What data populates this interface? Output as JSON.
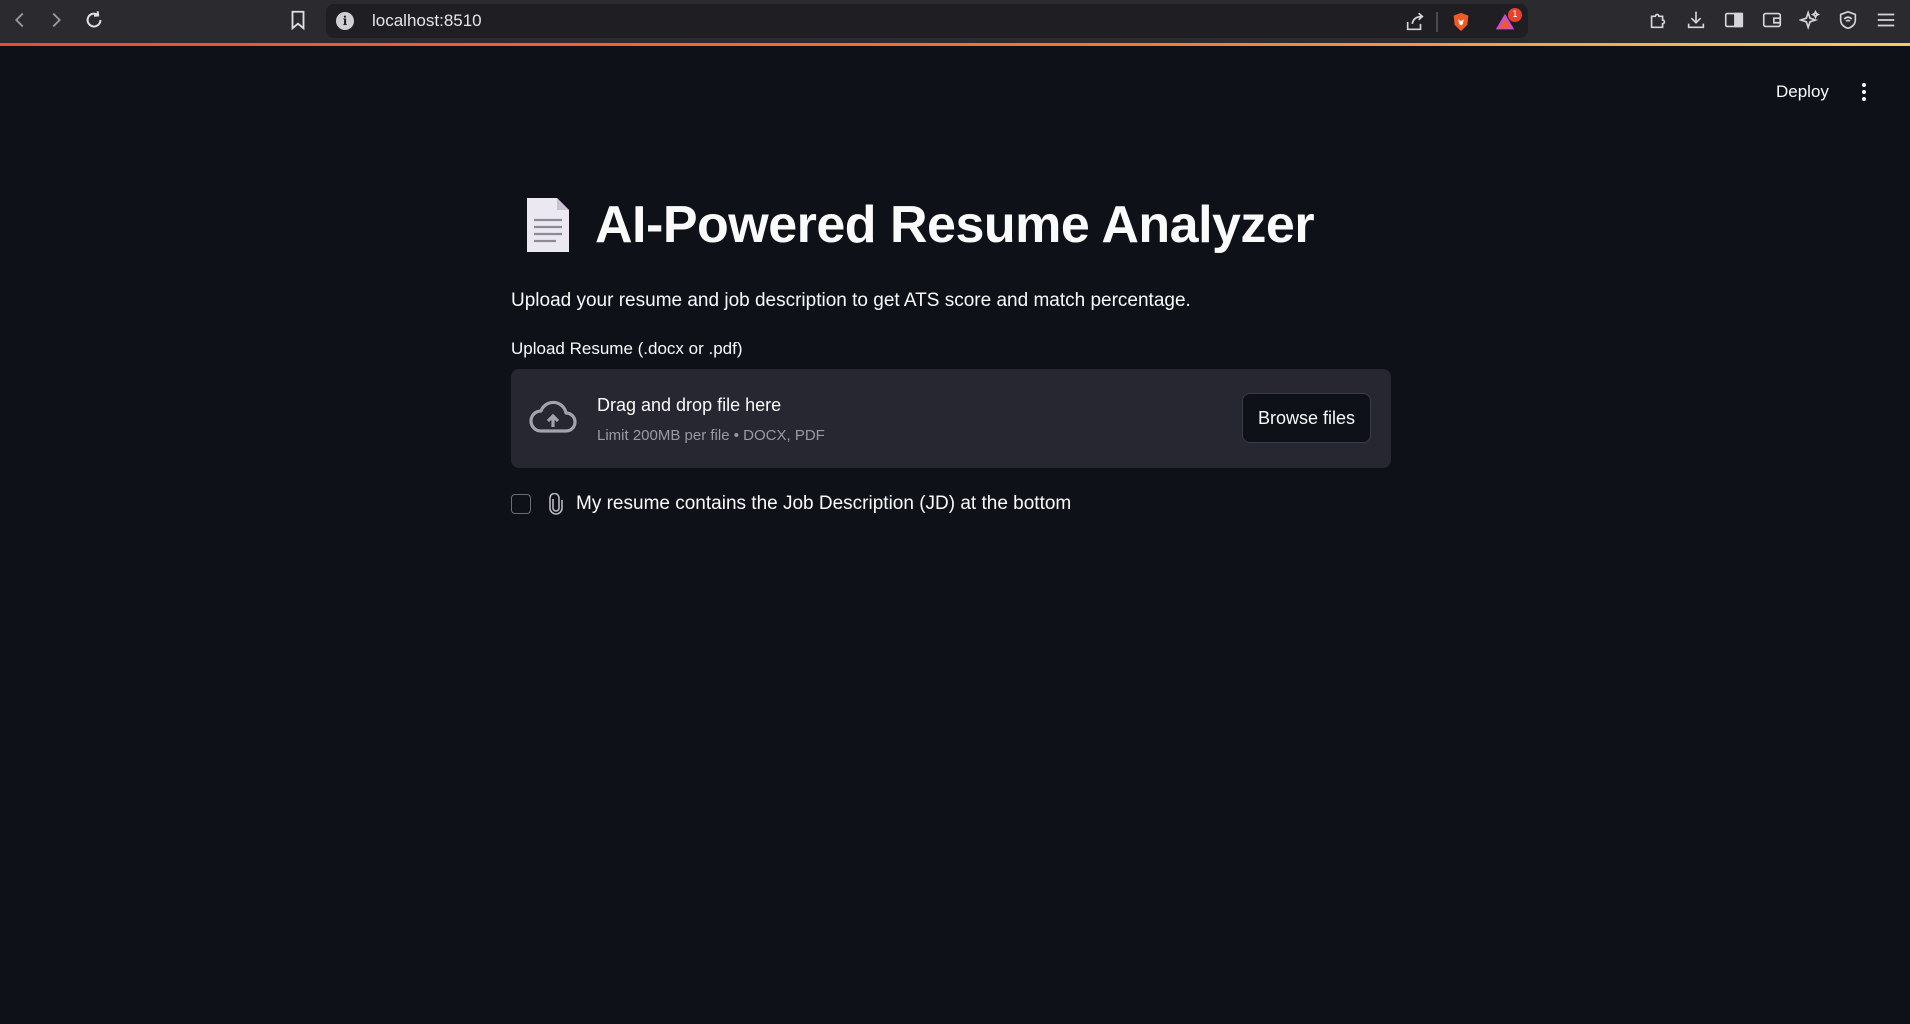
{
  "browser": {
    "url": "localhost:8510",
    "notification_count": "1"
  },
  "header": {
    "deploy_label": "Deploy"
  },
  "main": {
    "title": "AI-Powered Resume Analyzer",
    "subtitle": "Upload your resume and job description to get ATS score and match percentage.",
    "upload": {
      "label": "Upload Resume (.docx or .pdf)",
      "drop_text": "Drag and drop file here",
      "limit_text": "Limit 200MB per file • DOCX, PDF",
      "browse_label": "Browse files"
    },
    "checkbox": {
      "label": "My resume contains the Job Description (JD) at the bottom",
      "checked": false
    }
  },
  "icons": {
    "title_icon": "document-icon",
    "upload_icon": "cloud-upload-icon",
    "checkbox_icon": "paperclip-icon"
  },
  "colors": {
    "background": "#0e1117",
    "dropzone": "#262730",
    "browser_bar": "#2b2b2f"
  }
}
